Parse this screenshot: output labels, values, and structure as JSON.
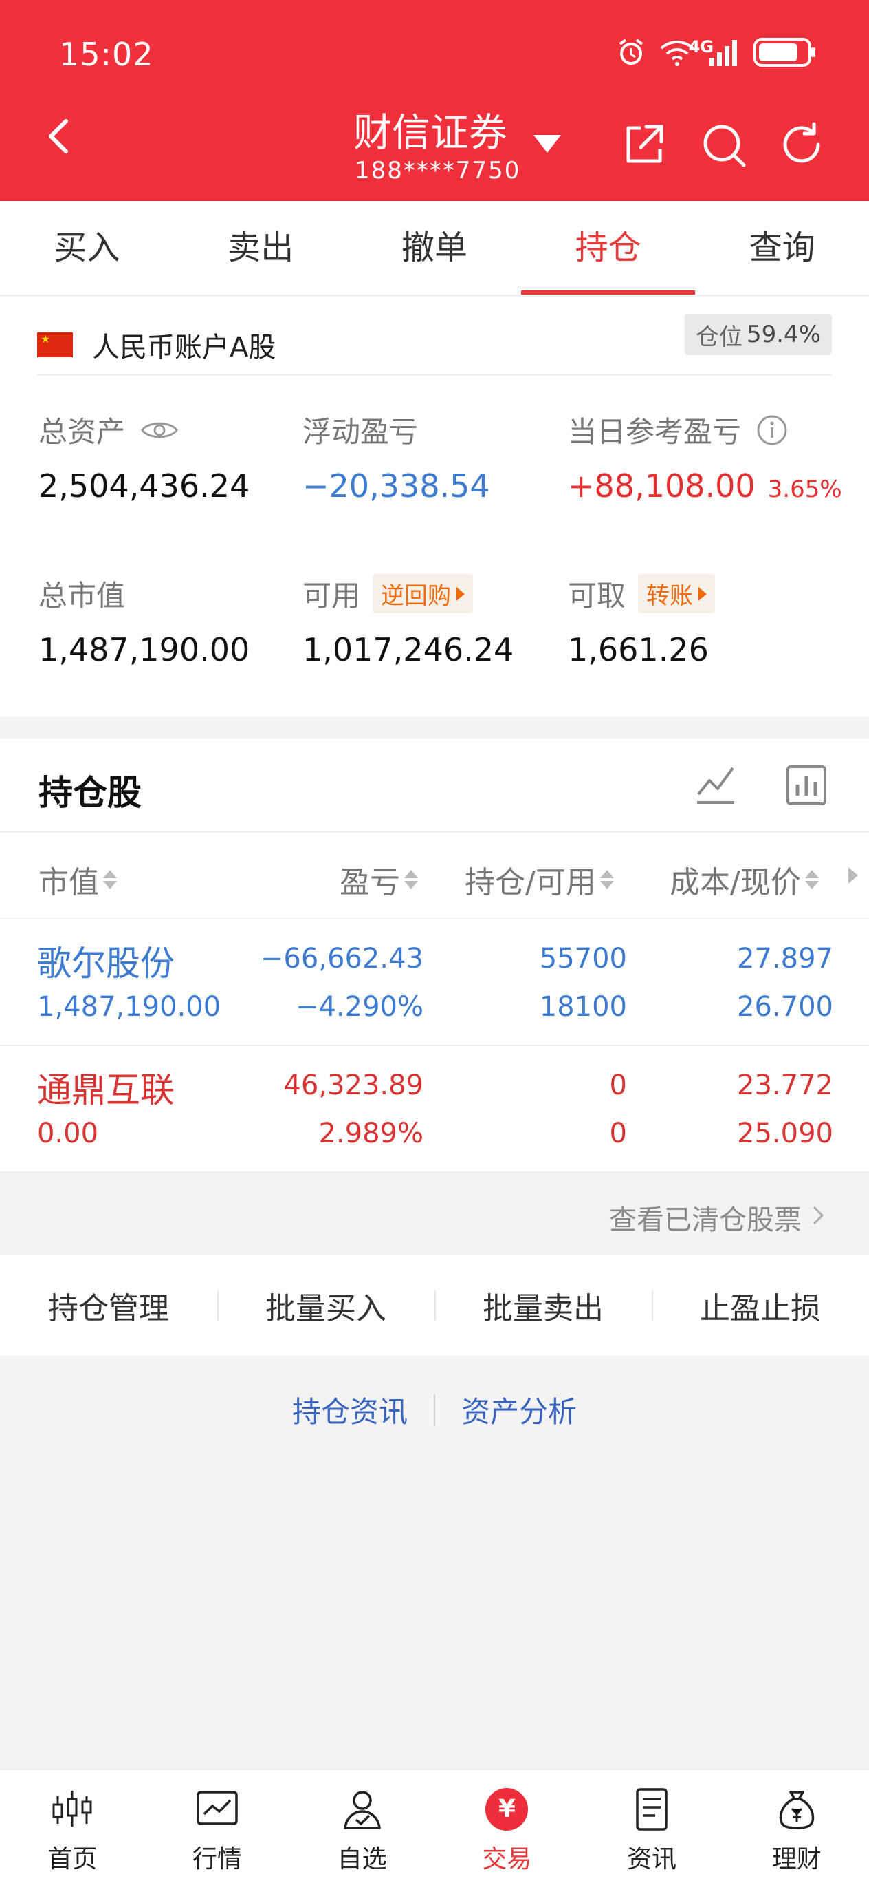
{
  "status_bar": {
    "time": "15:02",
    "network": "4G",
    "icons": [
      "alarm-icon",
      "wifi-icon",
      "signal-icon",
      "battery-icon"
    ]
  },
  "header": {
    "title": "财信证券",
    "account_masked": "188****7750",
    "icons": [
      "back-icon",
      "dropdown-caret-icon",
      "share-icon",
      "search-icon",
      "refresh-icon"
    ]
  },
  "tabs": [
    {
      "label": "买入",
      "active": false
    },
    {
      "label": "卖出",
      "active": false
    },
    {
      "label": "撤单",
      "active": false
    },
    {
      "label": "持仓",
      "active": true
    },
    {
      "label": "查询",
      "active": false
    }
  ],
  "account": {
    "label": "人民币账户A股",
    "position_label": "仓位",
    "position_value": "59.4%",
    "total_assets_label": "总资产",
    "total_assets": "2,504,436.24",
    "floating_pl_label": "浮动盈亏",
    "floating_pl": "−20,338.54",
    "daily_pl_label": "当日参考盈亏",
    "daily_pl": "+88,108.00",
    "daily_pl_pct": "3.65%",
    "market_value_label": "总市值",
    "market_value": "1,487,190.00",
    "available_label": "可用",
    "available": "1,017,246.24",
    "reverse_repo_label": "逆回购",
    "withdrawable_label": "可取",
    "withdrawable": "1,661.26",
    "transfer_label": "转账"
  },
  "holdings": {
    "title": "持仓股",
    "columns": [
      "市值",
      "盈亏",
      "持仓/可用",
      "成本/现价"
    ],
    "rows": [
      {
        "name": "歌尔股份",
        "market_value": "1,487,190.00",
        "pl": "−66,662.43",
        "pl_pct": "−4.290%",
        "hold": "55700",
        "available": "18100",
        "cost": "27.897",
        "price": "26.700",
        "color": "#3c7bd0"
      },
      {
        "name": "通鼎互联",
        "market_value": "0.00",
        "pl": "46,323.89",
        "pl_pct": "2.989%",
        "hold": "0",
        "available": "0",
        "cost": "23.772",
        "price": "25.090",
        "color": "#d93434"
      }
    ],
    "cleared_link": "查看已清仓股票"
  },
  "actions": [
    "持仓管理",
    "批量买入",
    "批量卖出",
    "止盈止损"
  ],
  "links": [
    "持仓资讯",
    "资产分析"
  ],
  "bottom_nav": [
    {
      "label": "首页",
      "icon": "candlestick-icon",
      "active": false
    },
    {
      "label": "行情",
      "icon": "chart-icon",
      "active": false
    },
    {
      "label": "自选",
      "icon": "user-check-icon",
      "active": false
    },
    {
      "label": "交易",
      "icon": "yen-icon",
      "active": true
    },
    {
      "label": "资讯",
      "icon": "news-icon",
      "active": false
    },
    {
      "label": "理财",
      "icon": "money-bag-icon",
      "active": false
    }
  ],
  "colors": {
    "brand_red": "#f0303a",
    "up_red": "#d93434",
    "down_blue": "#3c7bd0",
    "link_blue": "#3a65bf",
    "tag_orange": "#f06a0a"
  }
}
